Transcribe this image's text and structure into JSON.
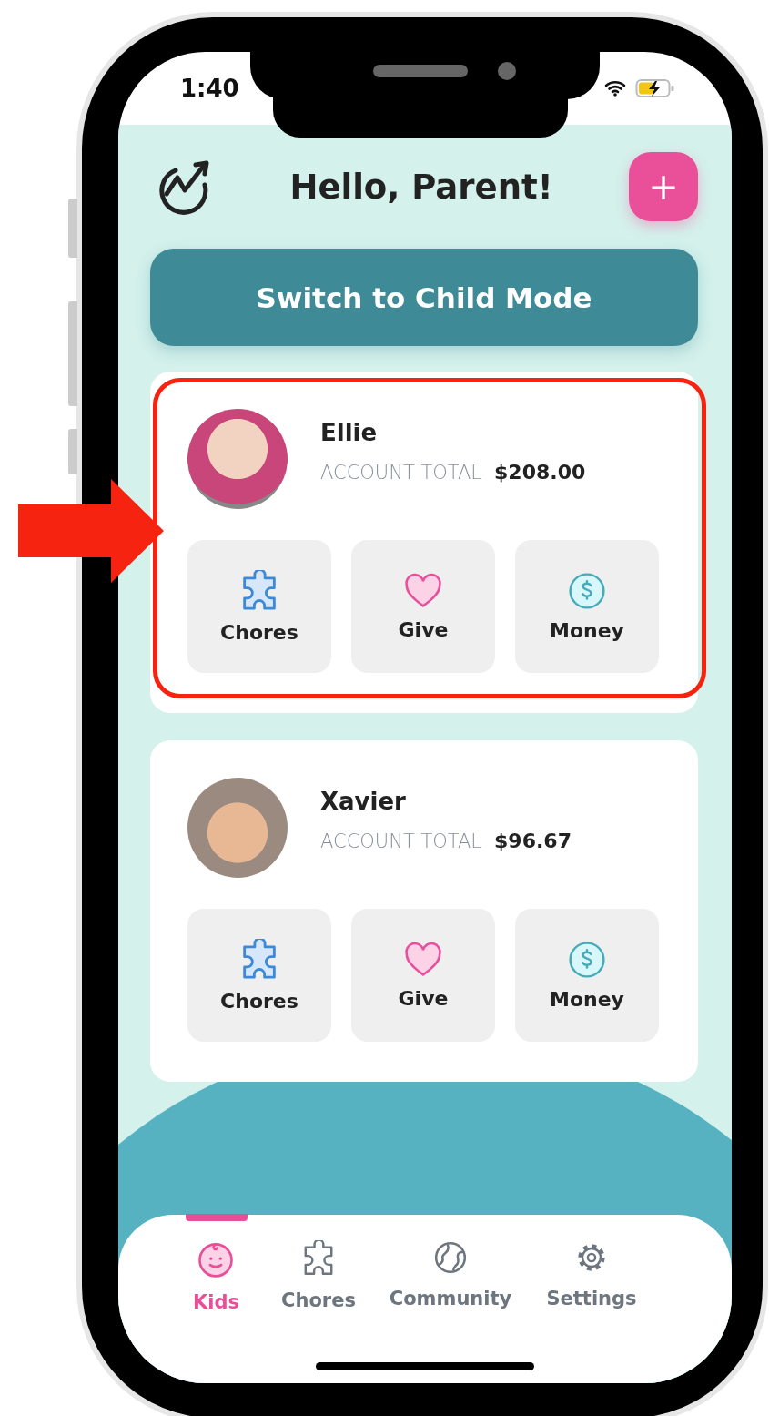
{
  "status_bar": {
    "time": "1:40"
  },
  "header": {
    "title": "Hello, Parent!",
    "add_button": "+"
  },
  "mode_button": "Switch to Child Mode",
  "kids": [
    {
      "name": "Ellie",
      "total_label": "ACCOUNT TOTAL",
      "total": "$208.00",
      "highlighted": true,
      "actions": [
        {
          "kind": "chores",
          "label": "Chores"
        },
        {
          "kind": "give",
          "label": "Give"
        },
        {
          "kind": "money",
          "label": "Money"
        }
      ]
    },
    {
      "name": "Xavier",
      "total_label": "ACCOUNT TOTAL",
      "total": "$96.67",
      "highlighted": false,
      "actions": [
        {
          "kind": "chores",
          "label": "Chores"
        },
        {
          "kind": "give",
          "label": "Give"
        },
        {
          "kind": "money",
          "label": "Money"
        }
      ]
    }
  ],
  "tab_bar": [
    {
      "kind": "kids",
      "label": "Kids",
      "selected": true
    },
    {
      "kind": "chores",
      "label": "Chores",
      "selected": false
    },
    {
      "kind": "community",
      "label": "Community",
      "selected": false
    },
    {
      "kind": "settings",
      "label": "Settings",
      "selected": false
    }
  ]
}
